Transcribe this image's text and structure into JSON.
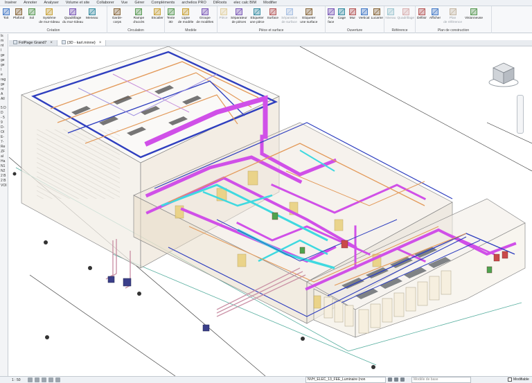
{
  "menu": {
    "tabs": [
      "Insérer",
      "Annoter",
      "Analyser",
      "Volume et site",
      "Collaborer",
      "Vue",
      "Gérer",
      "Compléments",
      "archelios PRO",
      "DiRoots",
      "elec calc BIM",
      "Modifier"
    ]
  },
  "ribbon": {
    "groups": [
      {
        "title": "Création",
        "buttons": [
          {
            "label": "Toit",
            "icon": "roof-icon"
          },
          {
            "label": "Plafond",
            "icon": "ceiling-icon"
          },
          {
            "label": "Sol",
            "icon": "floor-icon"
          },
          {
            "label": "Système\nde mur-rideau",
            "icon": "curtain-system-icon"
          },
          {
            "label": "Quadrillage\ndu mur-rideau",
            "icon": "curtain-grid-icon"
          },
          {
            "label": "Meneau",
            "icon": "mullion-icon"
          }
        ]
      },
      {
        "title": "Circulation",
        "buttons": [
          {
            "label": "Garde-corps",
            "icon": "railing-icon"
          },
          {
            "label": "Rampe d'accès",
            "icon": "ramp-icon"
          },
          {
            "label": "Escalier",
            "icon": "stair-icon"
          }
        ]
      },
      {
        "title": "Modèle",
        "buttons": [
          {
            "label": "Texte\n3D",
            "icon": "model-text-icon"
          },
          {
            "label": "Ligne\nde modèle",
            "icon": "model-line-icon"
          },
          {
            "label": "Groupe\nde modèles",
            "icon": "model-group-icon"
          }
        ]
      },
      {
        "title": "Pièce et surface",
        "buttons": [
          {
            "label": "Pièce",
            "icon": "room-icon",
            "dim": true
          },
          {
            "label": "Séparateur\nde pièces",
            "icon": "room-separator-icon"
          },
          {
            "label": "Etiqueter\nune pièce",
            "icon": "tag-room-icon"
          },
          {
            "label": "Surface",
            "icon": "area-icon"
          },
          {
            "label": "Séparation\nde surface",
            "icon": "area-boundary-icon",
            "dim": true
          },
          {
            "label": "Etiqueter\nune surface",
            "icon": "tag-area-icon"
          }
        ]
      },
      {
        "title": "Ouverture",
        "buttons": [
          {
            "label": "Par\nface",
            "icon": "by-face-icon"
          },
          {
            "label": "Cage",
            "icon": "shaft-icon"
          },
          {
            "label": "Mur",
            "icon": "wall-opening-icon"
          },
          {
            "label": "Vertical",
            "icon": "vertical-opening-icon"
          },
          {
            "label": "Lucarne",
            "icon": "dormer-icon"
          }
        ]
      },
      {
        "title": "Référence",
        "buttons": [
          {
            "label": "Niveau",
            "icon": "level-icon",
            "dim": true
          },
          {
            "label": "Quadrillage",
            "icon": "grid-icon",
            "dim": true
          }
        ]
      },
      {
        "title": "Plan de construction",
        "buttons": [
          {
            "label": "Définir",
            "icon": "set-workplane-icon"
          },
          {
            "label": "Afficher",
            "icon": "show-workplane-icon"
          },
          {
            "label": "Plan\nde référence",
            "icon": "ref-plane-icon",
            "dim": true
          },
          {
            "label": "Visionneuse",
            "icon": "viewer-icon"
          }
        ]
      }
    ]
  },
  "left_panel": {
    "fragments": [
      "ls",
      "m",
      "nt",
      "l",
      "ge",
      "ge",
      "ge",
      "l",
      "e",
      "rag",
      "ge",
      "nt",
      "A",
      "All",
      "",
      "5 D",
      "D",
      "- 5",
      "9",
      "D-",
      "Ol",
      "E-",
      "7-",
      "Re",
      "ZF",
      "al",
      "Ha",
      "N1",
      "N2",
      "2 B",
      "2 B",
      "VOI"
    ]
  },
  "doc_tabs": [
    {
      "label": "FolPage Grand7",
      "active": false,
      "icon": "sheet-icon"
    },
    {
      "label": "{3D - karl.minne}",
      "active": true,
      "icon": "3d-view-icon"
    }
  ],
  "status": {
    "scale": "1 : 50",
    "family": "NVH_ELEC_13_FEE_Luminaire (non",
    "model": "Modèle de base",
    "modifiable": "Modifiable"
  },
  "colors": {
    "duct_magenta": "#d050e8",
    "duct_cyan": "#3fd9e0",
    "pipe_blue": "#2f3fbf",
    "pipe_orange": "#e39a5a",
    "wall_fill": "#efe6d8",
    "wall_line": "#8f8f8f",
    "yellow_panel": "#e9cf7a"
  }
}
